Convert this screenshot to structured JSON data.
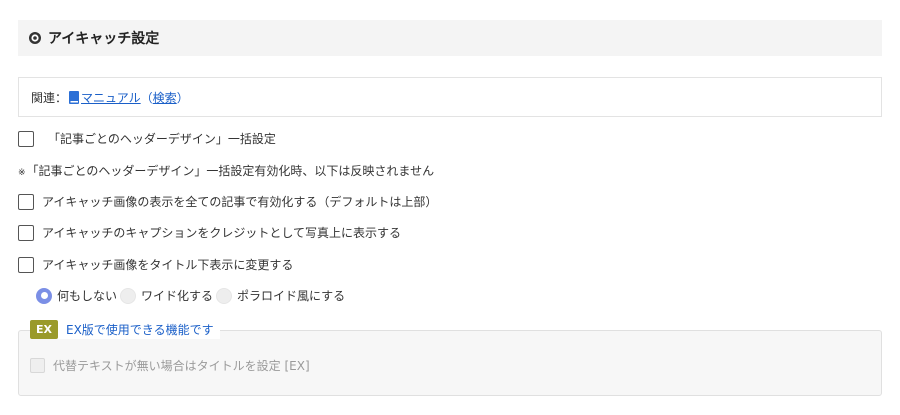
{
  "header": {
    "icon": "eye-icon",
    "title": "アイキャッチ設定"
  },
  "related": {
    "prefix": "関連：",
    "manual_icon": "book-icon",
    "manual_link": "マニュアル",
    "open_paren": "（",
    "search_link": "検索",
    "close_paren": "）"
  },
  "options": {
    "bulk_header_design": "「記事ごとのヘッダーデザイン」一括設定",
    "note_mark": "※",
    "note_text": "「記事ごとのヘッダーデザイン」一括設定有効化時、以下は反映されません",
    "show_all_articles": "アイキャッチ画像の表示を全ての記事で有効化する（デフォルトは上部）",
    "show_caption": "アイキャッチのキャプションをクレジットとして写真上に表示する",
    "below_title": "アイキャッチ画像をタイトル下表示に変更する"
  },
  "radio": {
    "selected": "何もしない",
    "options": [
      "何もしない",
      "ワイド化する",
      "ポラロイド風にする"
    ]
  },
  "ex": {
    "badge": "EX",
    "legend": "EX版で使用できる機能です",
    "alt_text_option": "代替テキストが無い場合はタイトルを設定 [EX]"
  },
  "colors": {
    "link": "#1a5fc8",
    "radio_selected": "#7b8fe6",
    "ex_badge": "#9a9a2a"
  }
}
